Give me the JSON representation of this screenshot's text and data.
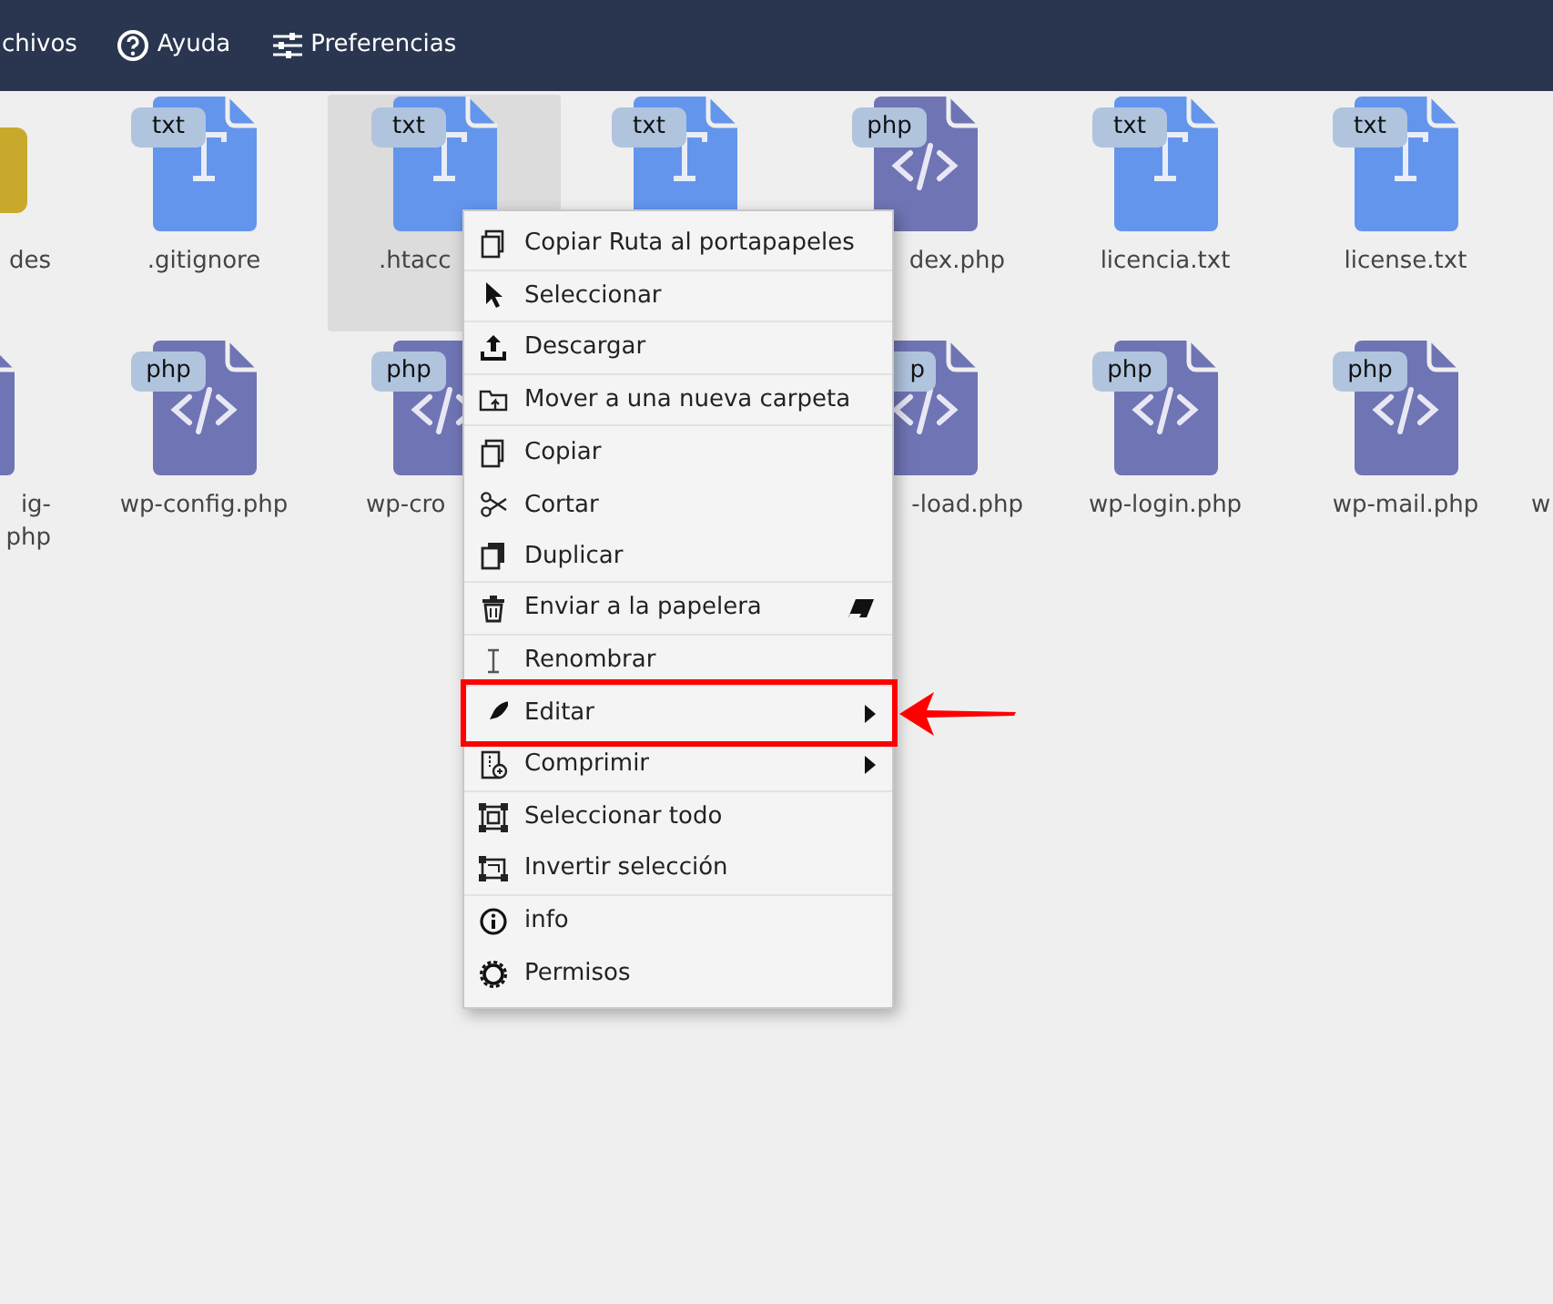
{
  "topbar": {
    "items": [
      {
        "label": "chivos"
      },
      {
        "label": "Ayuda"
      },
      {
        "label": "Preferencias"
      }
    ]
  },
  "rows": [
    [
      {
        "kind": "folder",
        "name": "des",
        "selected": false
      },
      {
        "kind": "txt",
        "badge": "txt",
        "name": ".gitignore",
        "selected": false
      },
      {
        "kind": "txt",
        "badge": "txt",
        "name": ".htacc",
        "selected": true
      },
      {
        "kind": "txt",
        "badge": "txt",
        "selected": false
      },
      {
        "kind": "php",
        "badge": "php",
        "name": "dex.php",
        "selected": false
      },
      {
        "kind": "txt",
        "badge": "txt",
        "name": "licencia.txt",
        "selected": false
      },
      {
        "kind": "txt",
        "badge": "txt",
        "name": "license.txt",
        "selected": false
      }
    ],
    [
      {
        "kind": "php",
        "name": "ig-\nphp",
        "selected": false
      },
      {
        "kind": "php",
        "badge": "php",
        "name": "wp-config.php",
        "selected": false
      },
      {
        "kind": "php",
        "badge": "php",
        "name": "wp-cro",
        "selected": false
      },
      {
        "kind": "none"
      },
      {
        "kind": "php",
        "badge": "p",
        "name": "-load.php",
        "selected": false
      },
      {
        "kind": "php",
        "badge": "php",
        "name": "wp-login.php",
        "selected": false
      },
      {
        "kind": "php",
        "badge": "php",
        "name": "wp-mail.php",
        "selected": false
      },
      {
        "kind": "none",
        "name": "w",
        "selected": false
      }
    ]
  ],
  "menu": {
    "items": [
      {
        "label": "Copiar Ruta al portapapeles",
        "separator": true,
        "submenu": false,
        "highlighted": false
      },
      {
        "label": "Seleccionar",
        "separator": true,
        "submenu": false,
        "highlighted": false
      },
      {
        "label": "Descargar",
        "separator": true,
        "submenu": false,
        "highlighted": false
      },
      {
        "label": "Mover a una nueva carpeta",
        "separator": true,
        "submenu": false,
        "highlighted": false
      },
      {
        "label": "Copiar",
        "separator": false,
        "submenu": false,
        "highlighted": false
      },
      {
        "label": "Cortar",
        "separator": false,
        "submenu": false,
        "highlighted": false
      },
      {
        "label": "Duplicar",
        "separator": true,
        "submenu": false,
        "highlighted": false
      },
      {
        "label": "Enviar a la papelera",
        "separator": true,
        "submenu": false,
        "highlighted": false
      },
      {
        "label": "Renombrar",
        "separator": true,
        "submenu": false,
        "highlighted": false
      },
      {
        "label": "Editar",
        "separator": false,
        "submenu": true,
        "highlighted": true
      },
      {
        "label": "Comprimir",
        "separator": true,
        "submenu": true,
        "highlighted": false
      },
      {
        "label": "Seleccionar todo",
        "separator": false,
        "submenu": false,
        "highlighted": false
      },
      {
        "label": "Invertir selección",
        "separator": true,
        "submenu": false,
        "highlighted": false
      },
      {
        "label": "info",
        "separator": false,
        "submenu": false,
        "highlighted": false
      },
      {
        "label": "Permisos",
        "separator": false,
        "submenu": false,
        "highlighted": false
      }
    ]
  }
}
